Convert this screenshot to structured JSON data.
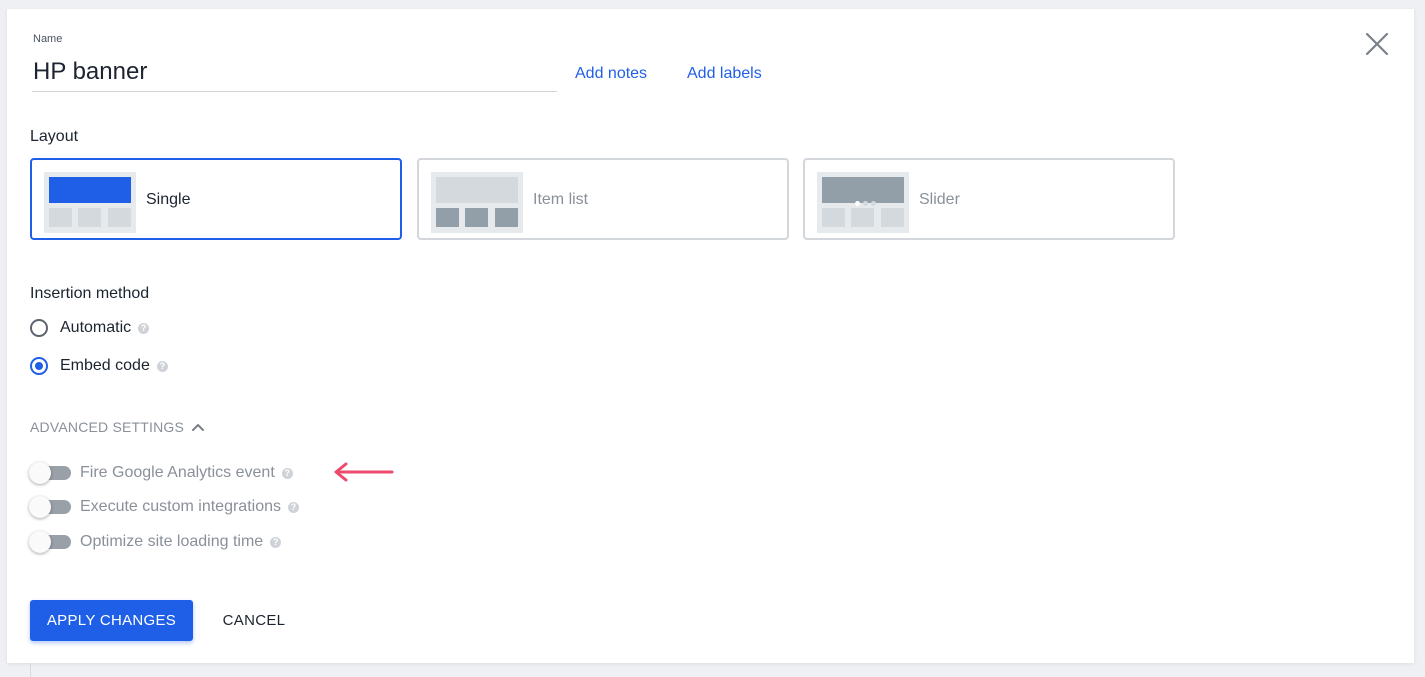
{
  "name_field": {
    "label": "Name",
    "value": "HP banner"
  },
  "links": {
    "add_notes": "Add notes",
    "add_labels": "Add labels"
  },
  "close_icon": "close-icon",
  "layout": {
    "title": "Layout",
    "selected": "Single",
    "options": [
      {
        "label": "Single",
        "selected": true
      },
      {
        "label": "Item list",
        "selected": false
      },
      {
        "label": "Slider",
        "selected": false
      }
    ]
  },
  "insertion": {
    "title": "Insertion method",
    "options": [
      {
        "label": "Automatic",
        "checked": false
      },
      {
        "label": "Embed code",
        "checked": true
      }
    ]
  },
  "advanced": {
    "label": "ADVANCED SETTINGS",
    "expanded": true,
    "toggles": [
      {
        "label": "Fire Google Analytics event",
        "on": false
      },
      {
        "label": "Execute custom integrations",
        "on": false
      },
      {
        "label": "Optimize site loading time",
        "on": false
      }
    ]
  },
  "annotation_arrow": {
    "color": "#ee4a6e"
  },
  "buttons": {
    "apply": "APPLY CHANGES",
    "cancel": "CANCEL"
  },
  "colors": {
    "accent": "#1f5fe8",
    "selected_thumb": "#1f5fe8",
    "thumb_light": "#d4d9dd",
    "thumb_dark": "#939fa8"
  }
}
